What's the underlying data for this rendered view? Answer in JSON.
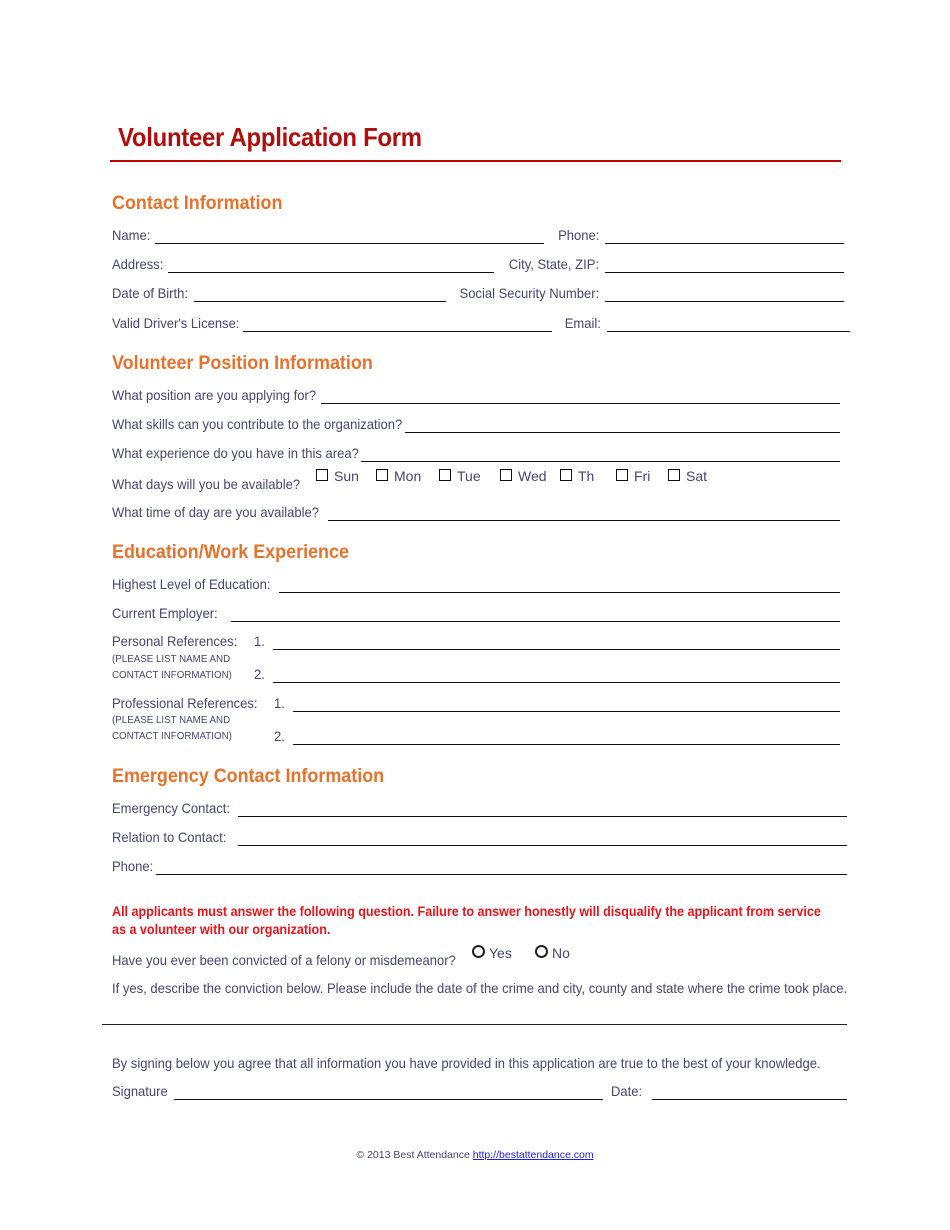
{
  "title": "Volunteer Application Form",
  "colors": {
    "title": "#b00d0d",
    "section": "#e8712b",
    "warning": "#e8141a",
    "label": "#444770",
    "link": "#1a22e6"
  },
  "contact": {
    "heading": "Contact Information",
    "name": "Name:",
    "phone": "Phone:",
    "address": "Address:",
    "city_state_zip": "City, State, ZIP:",
    "dob": "Date of Birth:",
    "ssn": "Social Security Number:",
    "license": "Valid Driver's License:",
    "email": "Email:"
  },
  "position": {
    "heading": "Volunteer Position Information",
    "applying_for": "What position are you applying for?",
    "skills": "What skills can you contribute to the organization?",
    "experience": "What experience do you have in this area?",
    "days": "What days will you be available?",
    "time": "What time of day are you available?",
    "day_options": [
      {
        "label": "Sun",
        "checked": false
      },
      {
        "label": "Mon",
        "checked": false
      },
      {
        "label": "Tue",
        "checked": false
      },
      {
        "label": "Wed",
        "checked": false
      },
      {
        "label": "Th",
        "checked": false
      },
      {
        "label": "Fri",
        "checked": false
      },
      {
        "label": "Sat",
        "checked": false
      }
    ]
  },
  "education": {
    "heading": "Education/Work Experience",
    "highest": "Highest Level of Education:",
    "employer": "Current Employer:",
    "personal_refs": "Personal References:",
    "professional_refs": "Professional References:",
    "note_line1": "(PLEASE LIST NAME AND",
    "note_line2": "CONTACT INFORMATION)",
    "num1": "1.",
    "num2": "2."
  },
  "emergency": {
    "heading": "Emergency Contact Information",
    "contact": "Emergency Contact:",
    "relation": "Relation to Contact:",
    "phone": "Phone:"
  },
  "conviction": {
    "warning_line1": "All applicants must answer the following question. Failure to answer honestly will disqualify the applicant from service",
    "warning_line2": "as a volunteer with our organization.",
    "question": "Have you ever been convicted of a felony or misdemeanor?",
    "yes": "Yes",
    "no": "No",
    "describe": "If yes, describe the conviction below. Please include the date of the crime and city, county and state where the crime took place."
  },
  "signature": {
    "agreement": "By signing below you agree that all information you have provided in this application are true to the best of your knowledge.",
    "signature_label": "Signature",
    "date_label": "Date:"
  },
  "footer": {
    "copyright": "© 2013 Best Attendance ",
    "link": "http://bestattendance.com"
  }
}
